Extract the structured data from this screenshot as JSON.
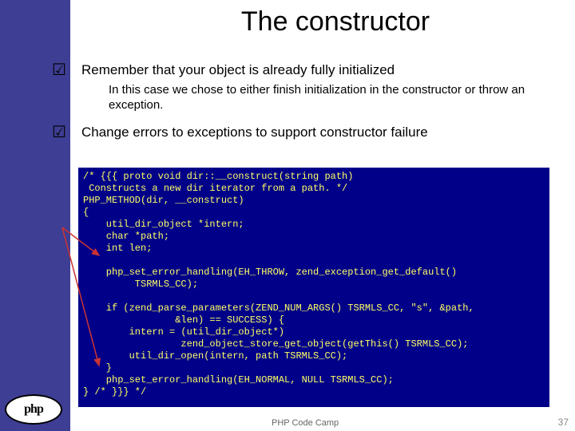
{
  "title": "The constructor",
  "bullets": [
    {
      "text": "Remember that your object is already fully initialized",
      "sub": "In this case we chose to either finish initialization in the constructor or throw an exception."
    },
    {
      "text": "Change errors to exceptions to support constructor failure"
    }
  ],
  "code": "/* {{{ proto void dir::__construct(string path)\n Constructs a new dir iterator from a path. */\nPHP_METHOD(dir, __construct)\n{\n    util_dir_object *intern;\n    char *path;\n    int len;\n\n    php_set_error_handling(EH_THROW, zend_exception_get_default()\n         TSRMLS_CC);\n\n    if (zend_parse_parameters(ZEND_NUM_ARGS() TSRMLS_CC, \"s\", &path,\n                &len) == SUCCESS) {\n        intern = (util_dir_object*)\n                 zend_object_store_get_object(getThis() TSRMLS_CC);\n        util_dir_open(intern, path TSRMLS_CC);\n    }\n    php_set_error_handling(EH_NORMAL, NULL TSRMLS_CC);\n} /* }}} */",
  "logo_text": "php",
  "footer": "PHP Code Camp",
  "page_number": "37"
}
